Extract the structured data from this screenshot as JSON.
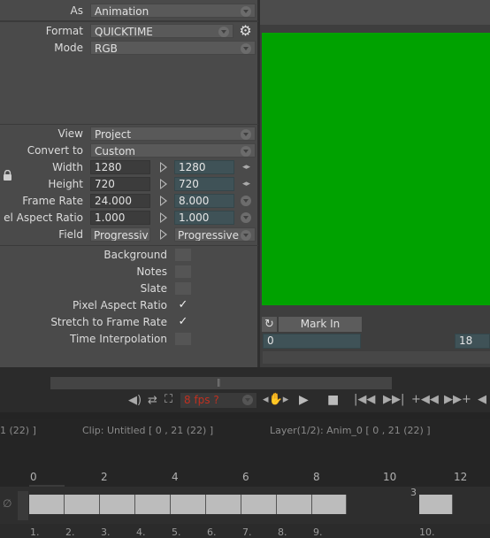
{
  "settings": {
    "as": {
      "label": "As",
      "value": "Animation"
    },
    "format": {
      "label": "Format",
      "value": "QUICKTIME"
    },
    "mode": {
      "label": "Mode",
      "value": "RGB"
    },
    "view": {
      "label": "View",
      "value": "Project"
    },
    "convert_to": {
      "label": "Convert to",
      "value": "Custom"
    },
    "width": {
      "label": "Width",
      "source": "1280",
      "target": "1280"
    },
    "height": {
      "label": "Height",
      "source": "720",
      "target": "720"
    },
    "frame_rate": {
      "label": "Frame Rate",
      "source": "24.000",
      "target": "8.000"
    },
    "pixel_aspect": {
      "label": "el Aspect Ratio",
      "source": "1.000",
      "target": "1.000"
    },
    "field": {
      "label": "Field",
      "source": "Progressiv",
      "target": "Progressive"
    },
    "options": [
      {
        "label": "Background",
        "checked": false
      },
      {
        "label": "Notes",
        "checked": false
      },
      {
        "label": "Slate",
        "checked": false
      },
      {
        "label": "Pixel Aspect Ratio",
        "checked": true
      },
      {
        "label": "Stretch to Frame Rate",
        "checked": true
      },
      {
        "label": "Time Interpolation",
        "checked": false
      }
    ]
  },
  "viewer": {
    "preview_color": "#00a200",
    "mark_in_label": "Mark In",
    "mark_in_value": "0",
    "mark_out_value": "18"
  },
  "transport": {
    "fps_text": "8 fps ?"
  },
  "info": {
    "left": "1  (22) ]",
    "clip": "Clip: Untitled [ 0 , 21  (22) ]",
    "layer": "Layer(1/2): Anim_0 [ 0 , 21  (22) ]"
  },
  "ruler": {
    "ticks": [
      "0",
      "2",
      "4",
      "6",
      "8",
      "10",
      "12"
    ]
  },
  "track": {
    "marker": "3",
    "frame_numbers": [
      "1.",
      "2.",
      "3.",
      "4.",
      "5.",
      "6.",
      "7.",
      "8.",
      "9.",
      "10."
    ]
  }
}
